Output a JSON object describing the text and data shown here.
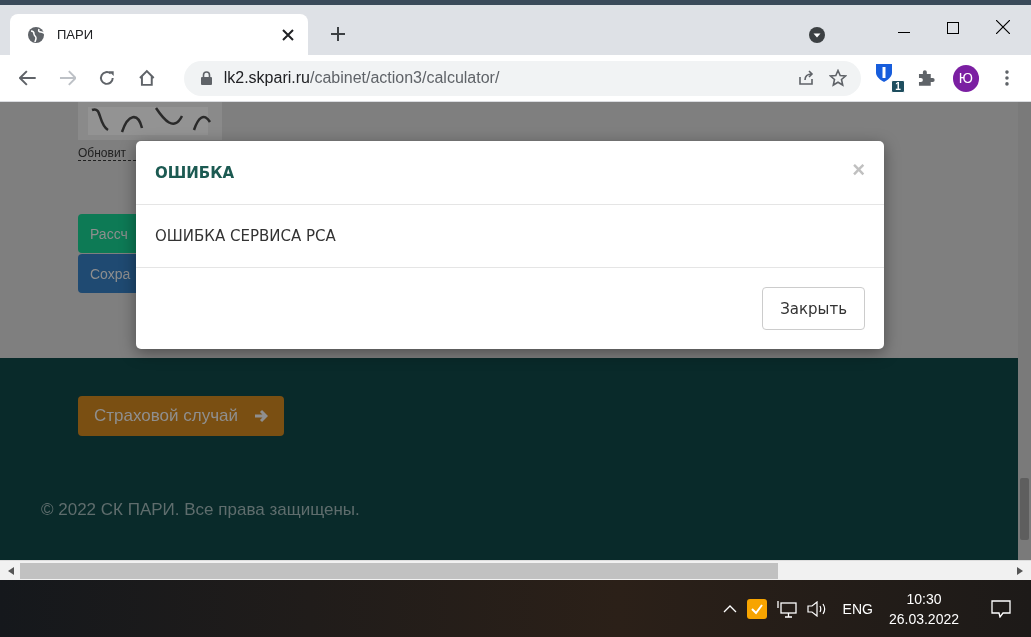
{
  "browser": {
    "tab": {
      "title": "ПАРИ"
    },
    "url_host": "lk2.skpari.ru",
    "url_path": "/cabinet/action3/calculator/",
    "extension_badge": "1",
    "profile_initial": "Ю"
  },
  "page": {
    "captcha_link": "Обновит",
    "buttons": [
      {
        "label": "Рассч",
        "kind": "calc"
      },
      {
        "label": "Сохра",
        "kind": "save"
      }
    ],
    "claim_button": "Страховой случай",
    "copyright": "© 2022 СК ПАРИ. Все права защищены."
  },
  "modal": {
    "title": "ОШИБКА",
    "close": "×",
    "message": "ОШИБКА СЕРВИСА РСА",
    "button": "Закрыть"
  },
  "taskbar": {
    "language": "ENG",
    "time": "10:30",
    "date": "26.03.2022"
  }
}
